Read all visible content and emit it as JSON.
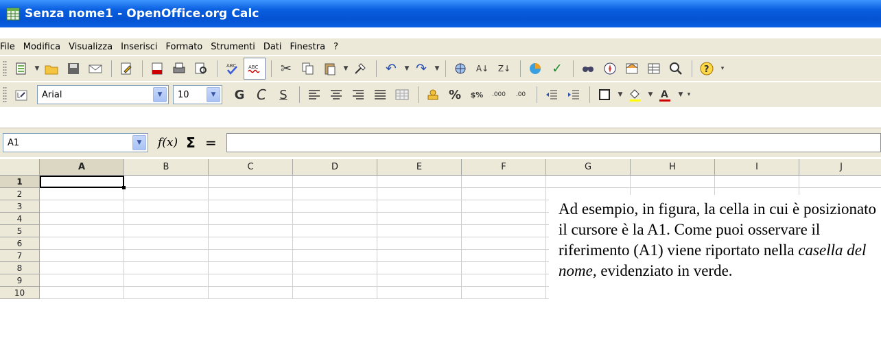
{
  "window": {
    "title": "Senza nome1 - OpenOffice.org Calc"
  },
  "menu": [
    "File",
    "Modifica",
    "Visualizza",
    "Inserisci",
    "Formato",
    "Strumenti",
    "Dati",
    "Finestra",
    "?"
  ],
  "format_toolbar": {
    "font_name": "Arial",
    "font_size": "10",
    "bold_label": "G",
    "italic_label": "C",
    "underline_label": "S",
    "percent_label": "%"
  },
  "formula_bar": {
    "name_box": "A1",
    "fx_label": "f(x)",
    "sum_label": "Σ",
    "equals_label": "=",
    "formula_value": ""
  },
  "sheet": {
    "columns": [
      "A",
      "B",
      "C",
      "D",
      "E",
      "F",
      "G",
      "H",
      "I",
      "J"
    ],
    "rows": [
      "1",
      "2",
      "3",
      "4",
      "5",
      "6",
      "7",
      "8",
      "9",
      "10"
    ],
    "active_cell": "A1"
  },
  "note": {
    "text_part1": "Ad esempio, in figura, la cella in cui è posizionato il cursore  è la A1. Come puoi osservare il riferimento (A1) viene riportato nella ",
    "text_emph": "casella del nome,",
    "text_part2": " evidenziato in verde."
  },
  "colors": {
    "title_bar": "#0a5fe0",
    "chrome": "#ece9d8",
    "selection_border": "#000000"
  }
}
